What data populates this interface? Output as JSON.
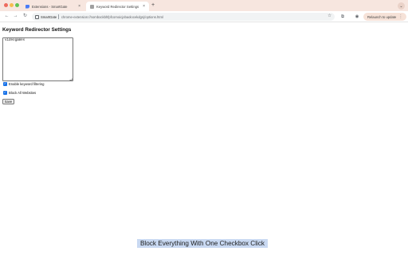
{
  "browser": {
    "tabs": [
      {
        "title": "Extensions - SmartGate",
        "close": "×"
      },
      {
        "title": "Keyword Redirector Settings",
        "close": "×"
      }
    ],
    "new_tab": "+",
    "tab_search": "⌄",
    "nav": {
      "back": "←",
      "forward": "→",
      "reload": "↻"
    },
    "omnibox": {
      "site_name": "SmartGate",
      "url": "chrome-extension://nombockbhfpfcomoicjobaolocekdgnj/options.html",
      "star": "☆"
    },
    "toolbar_icons": {
      "extensions": "⧉",
      "profile": "◉"
    },
    "relaunch_label": "Relaunch to update",
    "relaunch_menu": "⋮"
  },
  "page": {
    "title": "Keyword Redirector Settings",
    "keywords_value": "videogames",
    "enable_filtering_label": "Enable keyword filtering",
    "enable_filtering_checked": true,
    "block_all_label": "Block All Websites",
    "block_all_checked": true,
    "checkmark": "✓",
    "save_label": "Save"
  },
  "caption": "Block Everything With One Checkbox Click"
}
